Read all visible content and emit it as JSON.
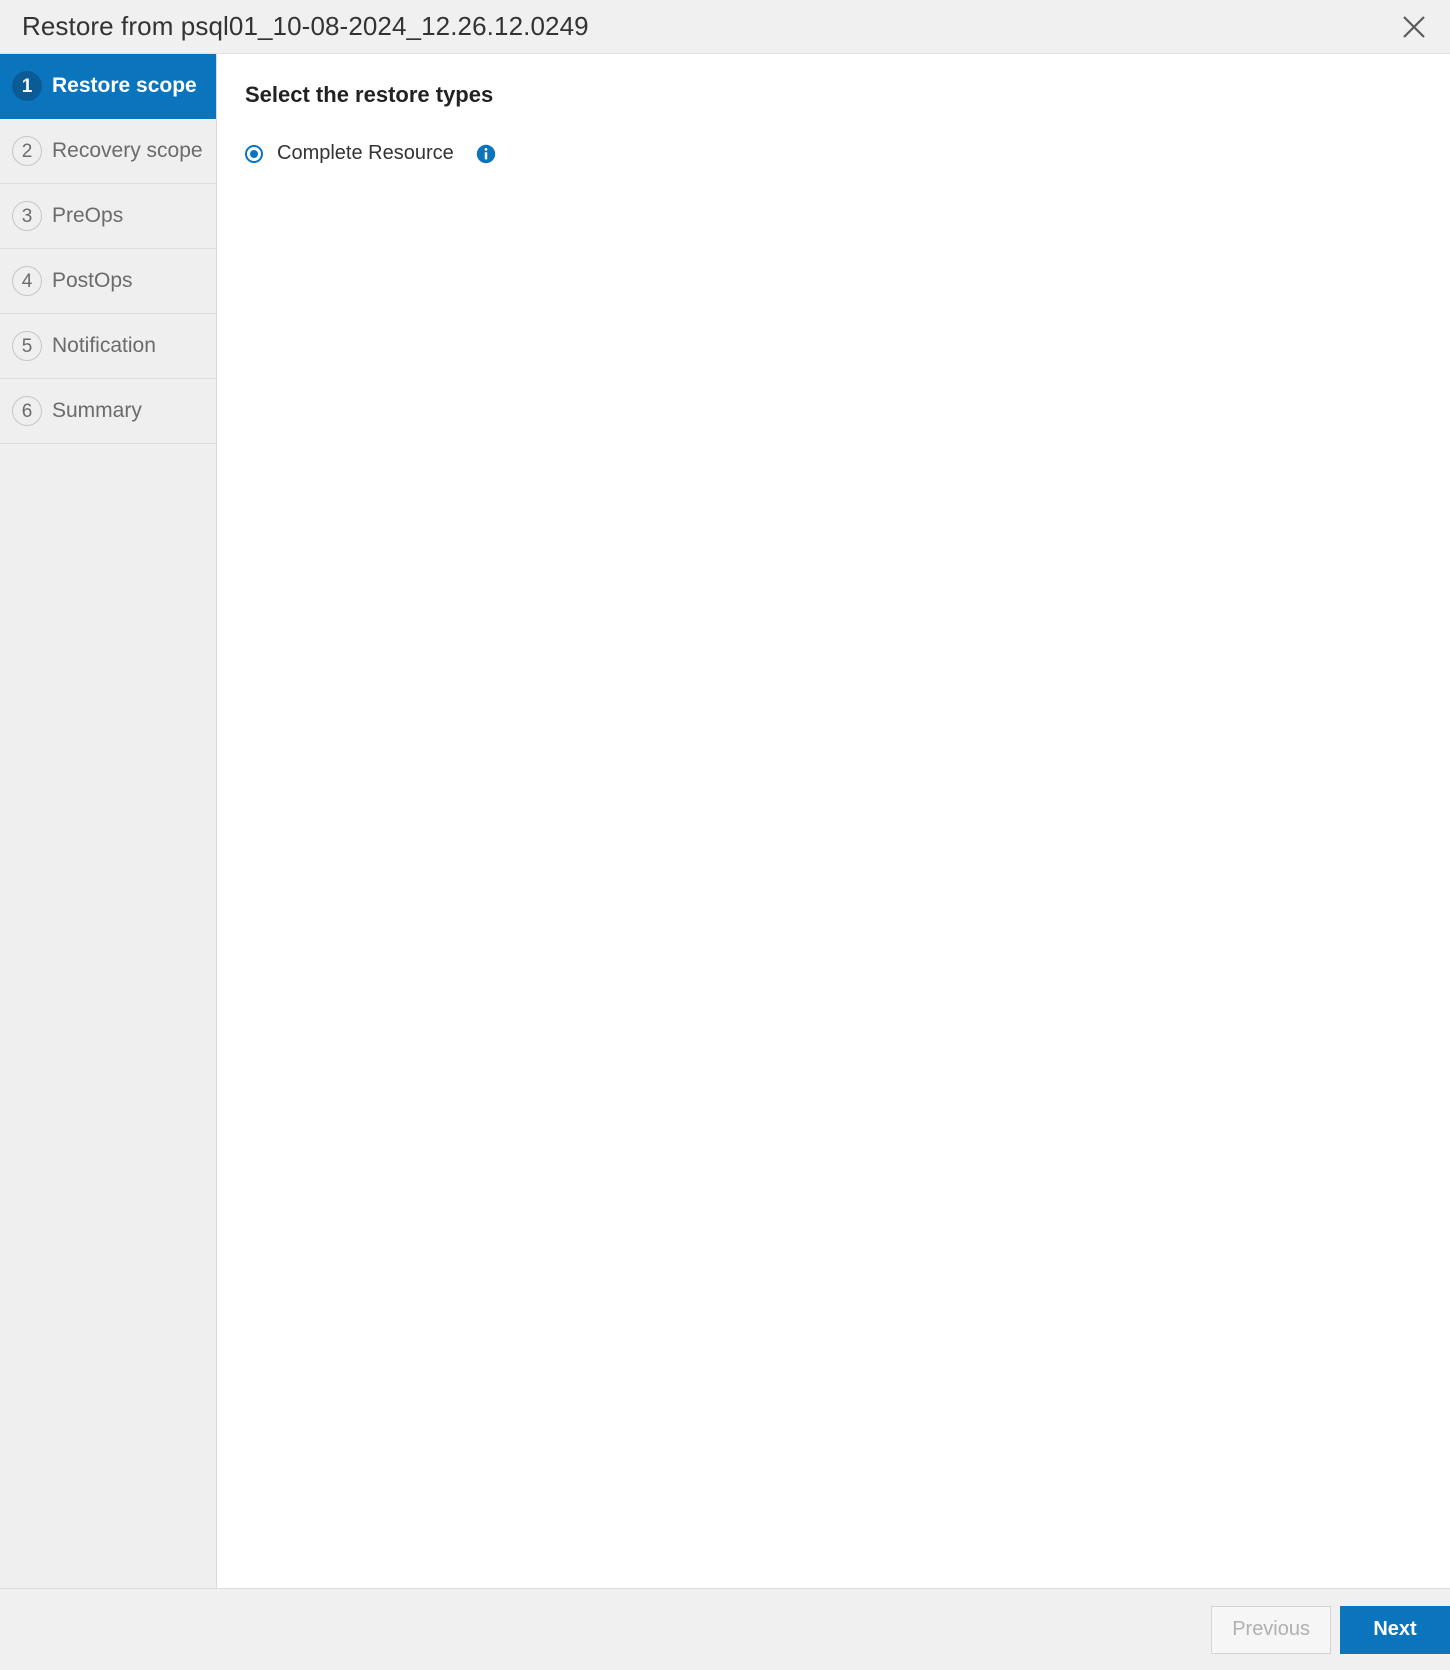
{
  "dialog": {
    "title": "Restore from psql01_10-08-2024_12.26.12.0249",
    "close_icon": "close-icon"
  },
  "wizard": {
    "steps": [
      {
        "number": "1",
        "label": "Restore scope",
        "active": true
      },
      {
        "number": "2",
        "label": "Recovery scope",
        "active": false
      },
      {
        "number": "3",
        "label": "PreOps",
        "active": false
      },
      {
        "number": "4",
        "label": "PostOps",
        "active": false
      },
      {
        "number": "5",
        "label": "Notification",
        "active": false
      },
      {
        "number": "6",
        "label": "Summary",
        "active": false
      }
    ]
  },
  "content": {
    "heading": "Select the restore types",
    "restore_types": [
      {
        "label": "Complete Resource",
        "selected": true,
        "info_icon": "info-icon"
      }
    ]
  },
  "footer": {
    "previous_label": "Previous",
    "next_label": "Next"
  },
  "colors": {
    "accent": "#0a74bc",
    "accent_dark": "#0b5c96",
    "chrome": "#f0f0f0",
    "sidebar": "#efefef",
    "text": "#333333",
    "muted_text": "#6b6b6b"
  }
}
